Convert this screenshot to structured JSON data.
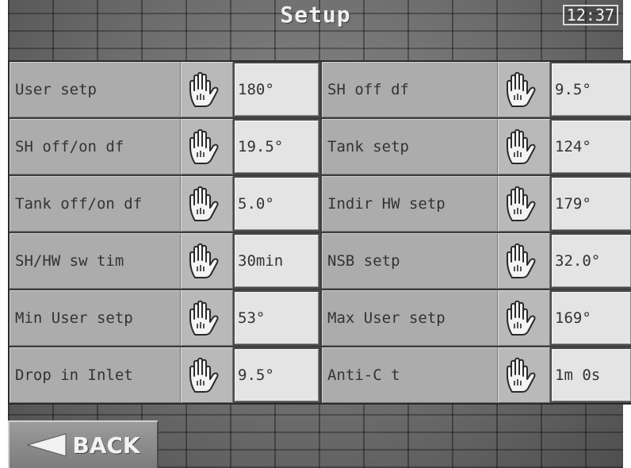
{
  "header": {
    "title": "Setup",
    "time": "12:37"
  },
  "settings": [
    {
      "label": "User setp",
      "value": "180°"
    },
    {
      "label": "SH off df",
      "value": "9.5°"
    },
    {
      "label": "SH off/on df",
      "value": "19.5°"
    },
    {
      "label": "Tank setp",
      "value": "124°"
    },
    {
      "label": "Tank off/on df",
      "value": "5.0°"
    },
    {
      "label": "Indir HW setp",
      "value": "179°"
    },
    {
      "label": "SH/HW sw tim",
      "value": "30min"
    },
    {
      "label": "NSB setp",
      "value": "32.0°"
    },
    {
      "label": "Min User setp",
      "value": "53°"
    },
    {
      "label": "Max User setp",
      "value": "169°"
    },
    {
      "label": "Drop in Inlet",
      "value": "9.5°"
    },
    {
      "label": "Anti-C t",
      "value": "1m 0s"
    }
  ],
  "footer": {
    "back_label": "BACK"
  },
  "icons": {
    "edit": "hand-icon",
    "back": "back-arrow-icon"
  }
}
